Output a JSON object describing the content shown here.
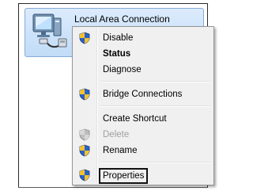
{
  "connection": {
    "name": "Local Area Connection",
    "icon": "network-adapter-icon"
  },
  "context_menu": {
    "items": [
      {
        "label": "Disable",
        "shield": true,
        "style": "normal"
      },
      {
        "label": "Status",
        "shield": false,
        "style": "bold"
      },
      {
        "label": "Diagnose",
        "shield": false,
        "style": "normal"
      },
      {
        "label": "Bridge Connections",
        "shield": true,
        "style": "normal"
      },
      {
        "label": "Create Shortcut",
        "shield": false,
        "style": "normal"
      },
      {
        "label": "Delete",
        "shield": true,
        "style": "disabled"
      },
      {
        "label": "Rename",
        "shield": true,
        "style": "normal"
      },
      {
        "label": "Properties",
        "shield": true,
        "style": "highlighted"
      }
    ]
  },
  "colors": {
    "selection_fill": "#c1dcf8",
    "selection_border": "#84acdd",
    "menu_background": "#f0f0f0",
    "disabled_text": "#a0a0a0"
  }
}
